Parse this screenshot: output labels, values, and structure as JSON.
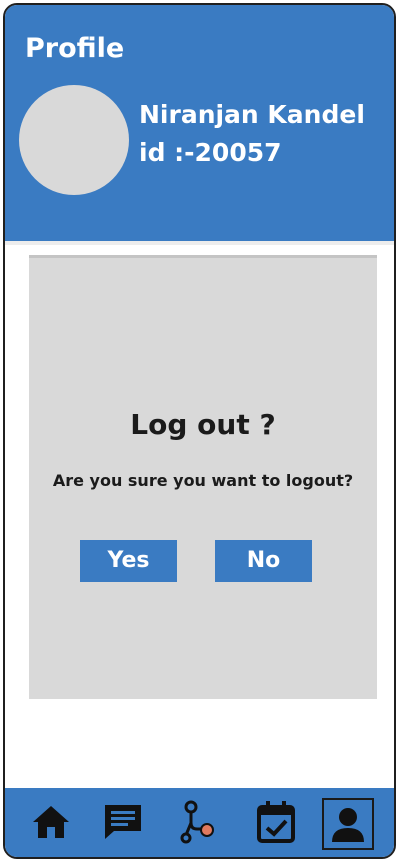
{
  "header": {
    "title": "Profile",
    "user_name": "Niranjan Kandel",
    "user_id": "id :-20057"
  },
  "dialog": {
    "title": "Log out ?",
    "message": "Are you sure you want to logout?",
    "yes_label": "Yes",
    "no_label": "No"
  },
  "bottom_nav": {
    "items": [
      {
        "icon": "home-icon"
      },
      {
        "icon": "chat-icon"
      },
      {
        "icon": "route-icon"
      },
      {
        "icon": "calendar-check-icon"
      },
      {
        "icon": "profile-icon",
        "active": true
      }
    ]
  },
  "colors": {
    "brand": "#3a7bc2",
    "dialog_bg": "#d9d9d9",
    "avatar_bg": "#d9d9d9",
    "route_accent": "#e07a5f"
  }
}
